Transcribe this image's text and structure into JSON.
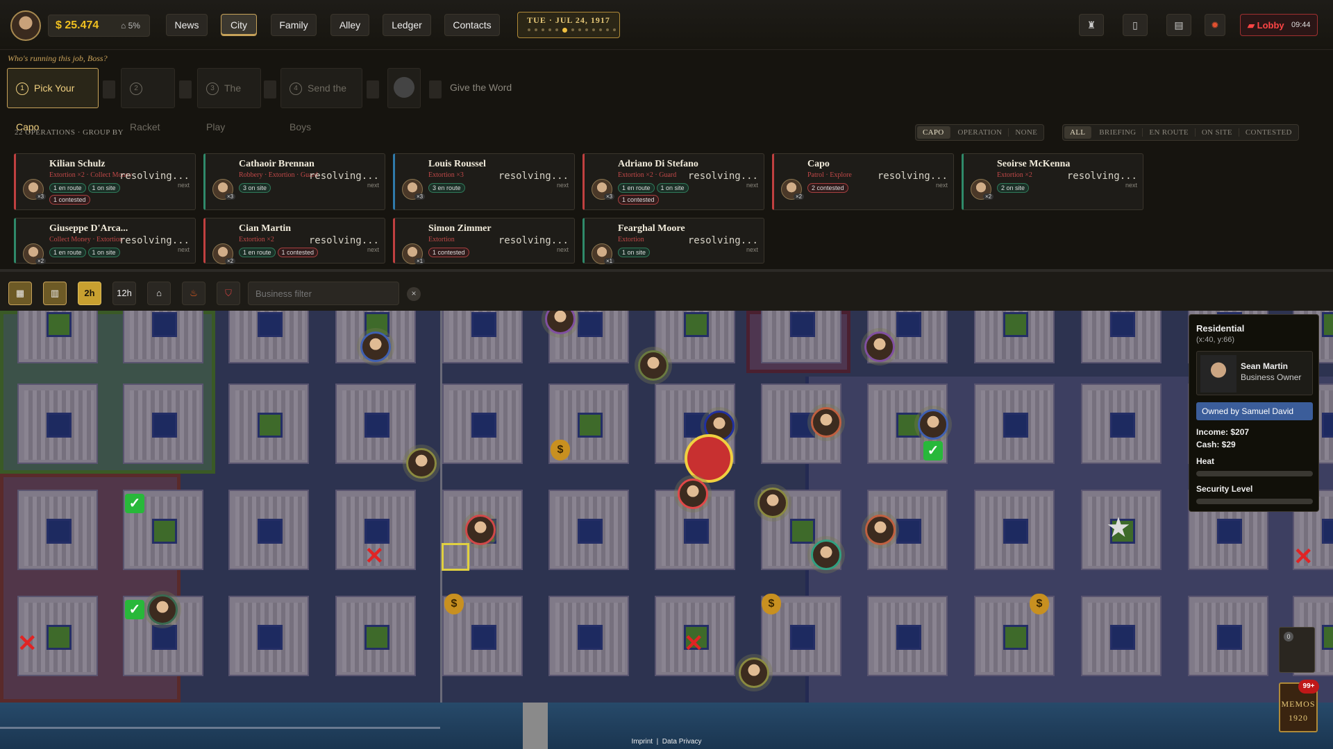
{
  "topbar": {
    "cash": "$ 25.474",
    "heat": "5%",
    "nav": [
      "News",
      "City",
      "Family",
      "Alley",
      "Ledger",
      "Contacts"
    ],
    "active_nav": "City",
    "date": "TUE · JUL 24, 1917",
    "lobby_label": "Lobby",
    "lobby_time": "09:44"
  },
  "capo_flow": {
    "prompt": "Who's running this job, Boss?",
    "steps": [
      {
        "num": "1",
        "label": "Pick Your Capo"
      },
      {
        "num": "2",
        "label": "Racket"
      },
      {
        "num": "3",
        "label": "The Play"
      },
      {
        "num": "4",
        "label": "Send the Boys"
      },
      {
        "num": "",
        "label": "Give the Word"
      }
    ]
  },
  "operations": {
    "header": "22 OPERATIONS · GROUP BY",
    "group_by": [
      "CAPO",
      "OPERATION",
      "NONE"
    ],
    "group_active": "CAPO",
    "filters": [
      "ALL",
      "BRIEFING",
      "EN ROUTE",
      "ON SITE",
      "CONTESTED"
    ],
    "filter_active": "ALL",
    "cards": [
      {
        "name": "Kilian Schulz",
        "type": "Extortion ×2 · Collect Money",
        "mult": "×3",
        "status": "resolving...",
        "next": "next",
        "pills": [
          "1 en route",
          "1 on site",
          "1 contested"
        ],
        "accent": "#c04040"
      },
      {
        "name": "Cathaoir Brennan",
        "type": "Robbery · Extortion · Guard",
        "mult": "×3",
        "status": "resolving...",
        "next": "next",
        "pills": [
          "3 on site"
        ],
        "accent": "#2f8a6a"
      },
      {
        "name": "Louis Roussel",
        "type": "Extortion ×3",
        "mult": "×3",
        "status": "resolving...",
        "next": "next",
        "pills": [
          "3 en route"
        ],
        "accent": "#2f7aaa"
      },
      {
        "name": "Adriano Di Stefano",
        "type": "Extortion ×2 · Guard",
        "mult": "×3",
        "status": "resolving...",
        "next": "next",
        "pills": [
          "1 en route",
          "1 on site",
          "1 contested"
        ],
        "accent": "#c04040"
      },
      {
        "name": "Capo",
        "type": "Patrol · Explore",
        "mult": "×2",
        "status": "resolving...",
        "next": "next",
        "pills": [
          "2 contested"
        ],
        "accent": "#c04040"
      },
      {
        "name": "Seoirse McKenna",
        "type": "Extortion ×2",
        "mult": "×2",
        "status": "resolving...",
        "next": "next",
        "pills": [
          "2 on site"
        ],
        "accent": "#2f8a6a"
      },
      {
        "name": "Giuseppe D'Arca...",
        "type": "Collect Money · Extortion",
        "mult": "×2",
        "status": "resolving...",
        "next": "next",
        "pills": [
          "1 en route",
          "1 on site"
        ],
        "accent": "#2f8a6a"
      },
      {
        "name": "Cian Martin",
        "type": "Extortion ×2",
        "mult": "×2",
        "status": "resolving...",
        "next": "next",
        "pills": [
          "1 en route",
          "1 contested"
        ],
        "accent": "#c04040"
      },
      {
        "name": "Simon Zimmer",
        "type": "Extortion",
        "mult": "×1",
        "status": "resolving...",
        "next": "next",
        "pills": [
          "1 contested"
        ],
        "accent": "#c04040"
      },
      {
        "name": "Fearghal Moore",
        "type": "Extortion",
        "mult": "×1",
        "status": "resolving...",
        "next": "next",
        "pills": [
          "1 on site"
        ],
        "accent": "#2f8a6a"
      }
    ]
  },
  "toolbar": {
    "time_2h": "2h",
    "time_12h": "12h",
    "filter_placeholder": "Business filter",
    "clear": "×"
  },
  "info": {
    "title": "Residential",
    "coords": "(x:40, y:66)",
    "owner_name": "Sean Martin",
    "owner_role": "Business Owner",
    "owned_by": "Owned by Samuel David",
    "income": "Income: $207",
    "cash": "Cash: $29",
    "heat_label": "Heat",
    "security_label": "Security Level"
  },
  "memos": {
    "line1": "MEMOS",
    "line2": "1920",
    "badge": "99+",
    "side_count": "0"
  },
  "footer": {
    "imprint": "Imprint",
    "sep": "|",
    "privacy": "Data Privacy"
  }
}
